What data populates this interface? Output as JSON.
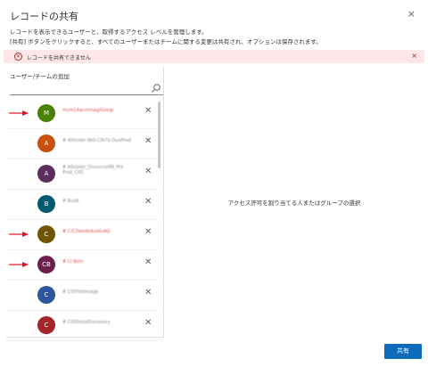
{
  "dialog": {
    "title": "レコードの共有",
    "close_glyph": "×",
    "description_line1": "レコードを表示できるユーザーと、取得するアクセス レベルを管理します。",
    "description_line2": "[共有] ボタンをクリックすると、すべてのユーザーまたはチームに関する変更は共有され、オプションは保存されます。"
  },
  "error": {
    "icon": "error-circle-icon",
    "icon_glyph": "✕",
    "message": "レコードを共有できません",
    "close_glyph": "×",
    "background": "#fde7e9",
    "accent": "#a4262c"
  },
  "left_panel": {
    "add_label": "ユーザー/チームの追加",
    "search_placeholder": "",
    "remove_glyph": "✕",
    "items": [
      {
        "initials": "M",
        "color": "#498205",
        "name": "mcm14acrnmag/Googl",
        "highlighted": true
      },
      {
        "initials": "A",
        "color": "#ca5010",
        "name": "# AllUsiler-9b0-C0t7a DunProd",
        "highlighted": false
      },
      {
        "initials": "A",
        "color": "#5c2e5c",
        "name": "# AllUsiler_Dnounce9N_Pre Prod_C05",
        "highlighted": false
      },
      {
        "initials": "B",
        "color": "#005b70",
        "name": "# Build",
        "highlighted": false
      },
      {
        "initials": "C",
        "color": "#6f5500",
        "name": "# C/CDeededu/eluAG",
        "highlighted": true
      },
      {
        "initials": "CB",
        "color": "#6b1f4a",
        "name": "# CI Bots",
        "highlighted": true
      },
      {
        "initials": "C",
        "color": "#2b579a",
        "name": "# C05Fetlenage",
        "highlighted": false
      },
      {
        "initials": "C",
        "color": "#a4262c",
        "name": "# C05DetalDiscovery",
        "highlighted": false
      }
    ]
  },
  "right_panel": {
    "empty_message": "アクセス許可を割り当てる人またはグループの選択"
  },
  "footer": {
    "share_label": "共有",
    "share_color": "#0f6cbd"
  },
  "annotation_color": "#e81123"
}
